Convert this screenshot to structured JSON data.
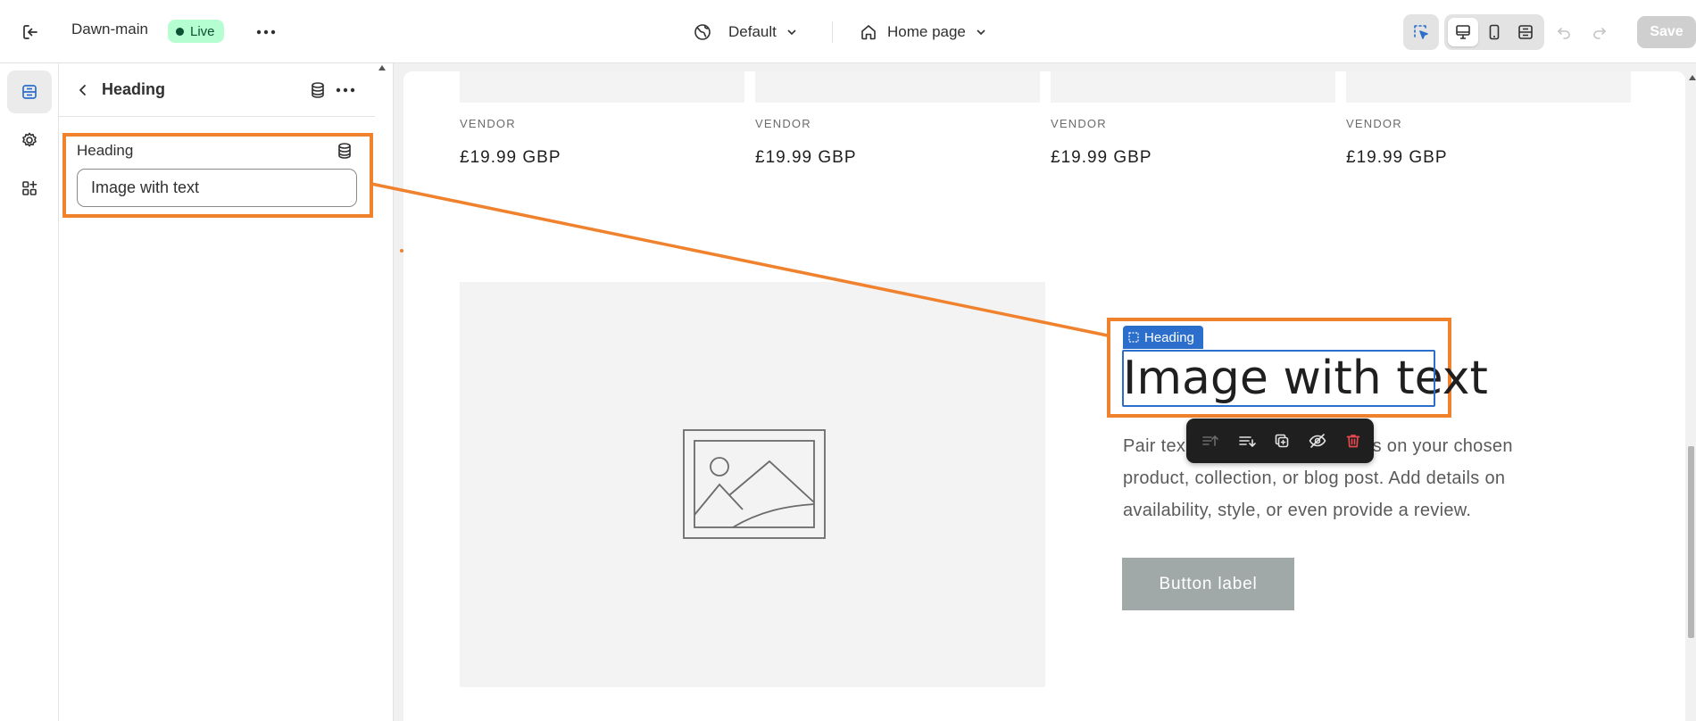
{
  "topbar": {
    "store_name": "Dawn-main",
    "status_badge": "Live",
    "theme_label": "Default",
    "page_label": "Home page",
    "save_label": "Save"
  },
  "sidebar": {
    "title": "Heading",
    "field": {
      "label": "Heading",
      "value": "Image with text"
    }
  },
  "preview": {
    "products": [
      {
        "vendor": "VENDOR",
        "price": "£19.99 GBP"
      },
      {
        "vendor": "VENDOR",
        "price": "£19.99 GBP"
      },
      {
        "vendor": "VENDOR",
        "price": "£19.99 GBP"
      },
      {
        "vendor": "VENDOR",
        "price": "£19.99 GBP"
      }
    ],
    "image_with_text": {
      "selection_label": "Heading",
      "heading": "Image with text",
      "body": "Pair text with an image to focus on your chosen product, collection, or blog post. Add details on availability, style, or even provide a review.",
      "body_visible_start": "Pair tex",
      "body_visible_line1_end": "us on your chosen",
      "body_line2": "product, collection, or blog post. Add details on",
      "body_line3": "availability, style, or even provide a review.",
      "button_label": "Button label"
    }
  },
  "colors": {
    "accent_orange": "#f0822e",
    "selection_blue": "#2c6ecb",
    "live_badge_bg": "#b4fed2",
    "button_bg": "#a0a9a7",
    "toolbar_bg": "#1f1f1f",
    "delete_red": "#e5484d"
  }
}
